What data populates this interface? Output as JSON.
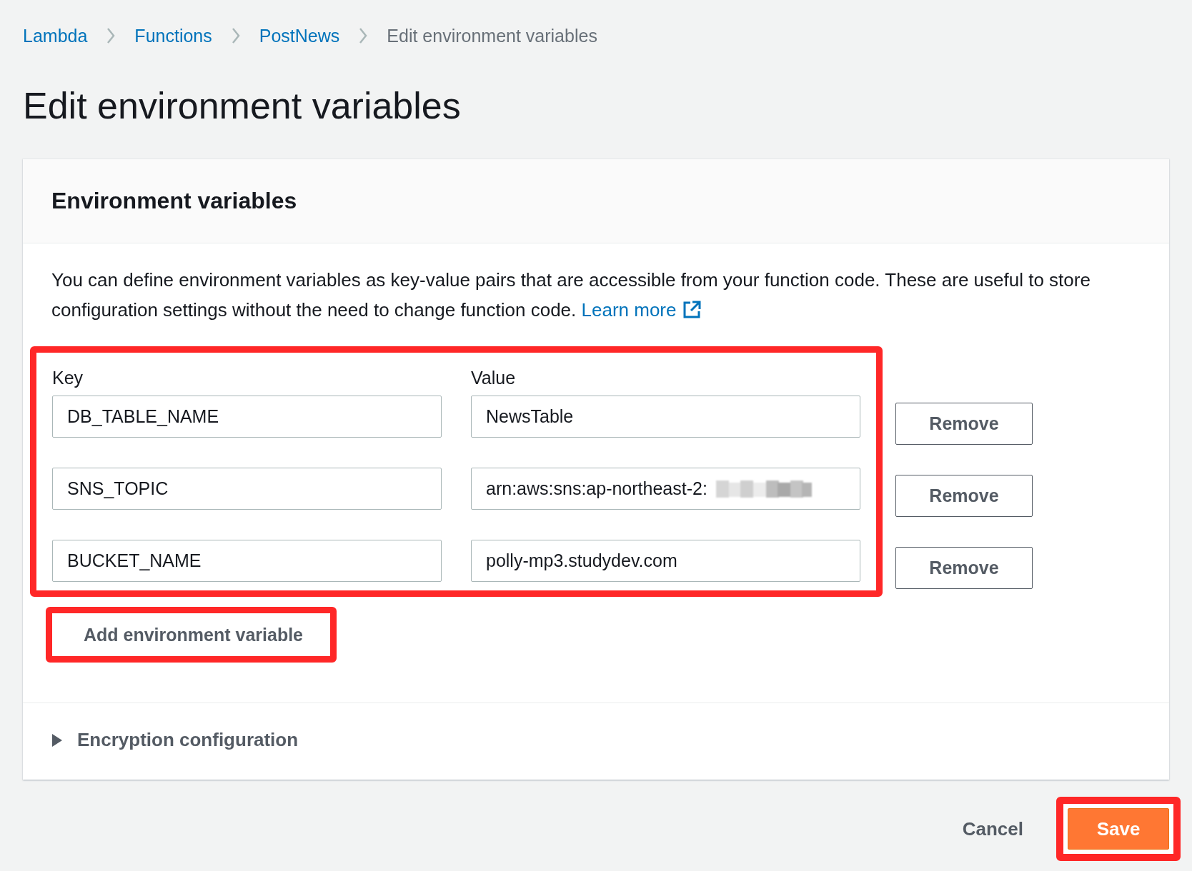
{
  "breadcrumb": [
    {
      "label": "Lambda",
      "link": true
    },
    {
      "label": "Functions",
      "link": true
    },
    {
      "label": "PostNews",
      "link": true
    },
    {
      "label": "Edit environment variables",
      "link": false
    }
  ],
  "page_title": "Edit environment variables",
  "environment_variables": {
    "title": "Environment variables",
    "description": "You can define environment variables as key-value pairs that are accessible from your function code. These are useful to store configuration settings without the need to change function code.",
    "learn_more": "Learn more",
    "highlighted": true,
    "columns": [
      "Key",
      "Value"
    ],
    "rows": [
      {
        "key": "DB_TABLE_NAME",
        "value": "NewsTable",
        "redacted": false,
        "remove": "Remove"
      },
      {
        "key": "SNS_TOPIC",
        "value": "arn:aws:sns:ap-northeast-2:",
        "redacted": true,
        "remove": "Remove"
      },
      {
        "key": "BUCKET_NAME",
        "value": "polly-mp3.studydev.com",
        "redacted": false,
        "remove": "Remove"
      }
    ],
    "add_button": {
      "label": "Add environment variable",
      "highlighted": true
    },
    "encryption": {
      "label": "Encryption configuration",
      "expanded": false
    }
  },
  "actions": {
    "cancel": "Cancel",
    "save": {
      "label": "Save",
      "highlighted": true
    }
  }
}
